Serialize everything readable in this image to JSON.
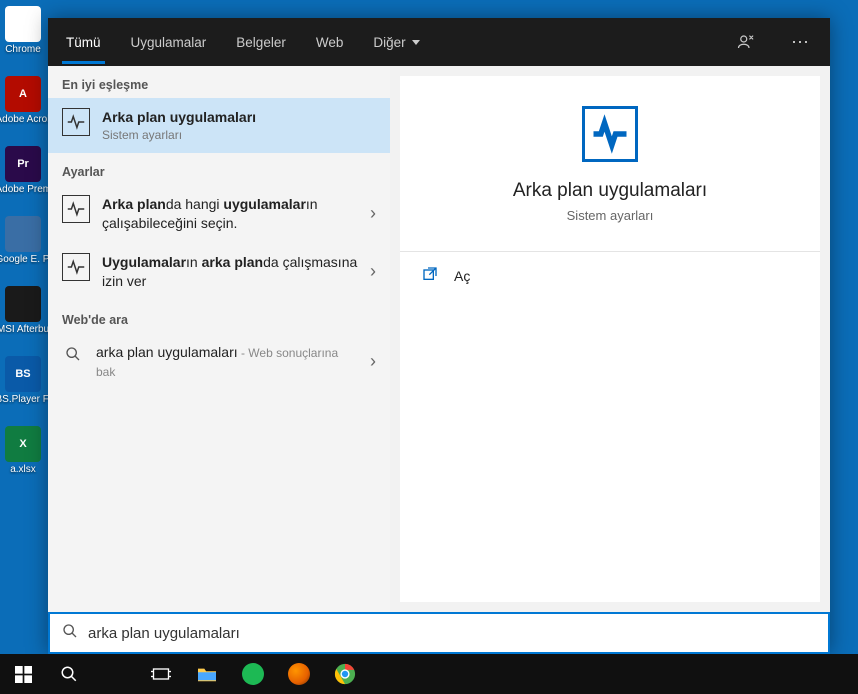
{
  "desktop_icons": [
    {
      "label": "Chrome",
      "bg": "#ffffff"
    },
    {
      "label": "Adobe Acroba",
      "bg": "#b30b00"
    },
    {
      "label": "Adobe Premiere",
      "bg": "#2a0a4a"
    },
    {
      "label": "Google E. Pro",
      "bg": "#3a6ea5"
    },
    {
      "label": "MSI Afterbu",
      "bg": "#1a1a1a"
    },
    {
      "label": "BS.Player FREE",
      "bg": "#0a5aa8"
    },
    {
      "label": "a.xlsx",
      "bg": "#107c41"
    }
  ],
  "header": {
    "tabs": [
      "Tümü",
      "Uygulamalar",
      "Belgeler",
      "Web",
      "Diğer"
    ],
    "selected": 0
  },
  "sections": {
    "best_match": "En iyi eşleşme",
    "settings": "Ayarlar",
    "web": "Web'de ara"
  },
  "best_title": "Arka plan uygulamaları",
  "best_sub": "Sistem ayarları",
  "setting1_pre": "Arka plan",
  "setting1_mid": "da hangi ",
  "setting1_bold": "uygulamalar",
  "setting1_post": "ın çalışabileceğini seçin.",
  "setting2_pre": "Uygulamalar",
  "setting2_mid": "ın ",
  "setting2_bold": "arka plan",
  "setting2_post": "da çalışmasına izin ver",
  "web_row_main": "arka plan uygulamaları",
  "web_row_sub": " - Web sonuçlarına bak",
  "detail": {
    "title": "Arka plan uygulamaları",
    "sub": "Sistem ayarları",
    "open": "Aç"
  },
  "search_value": "arka plan uygulamaları"
}
